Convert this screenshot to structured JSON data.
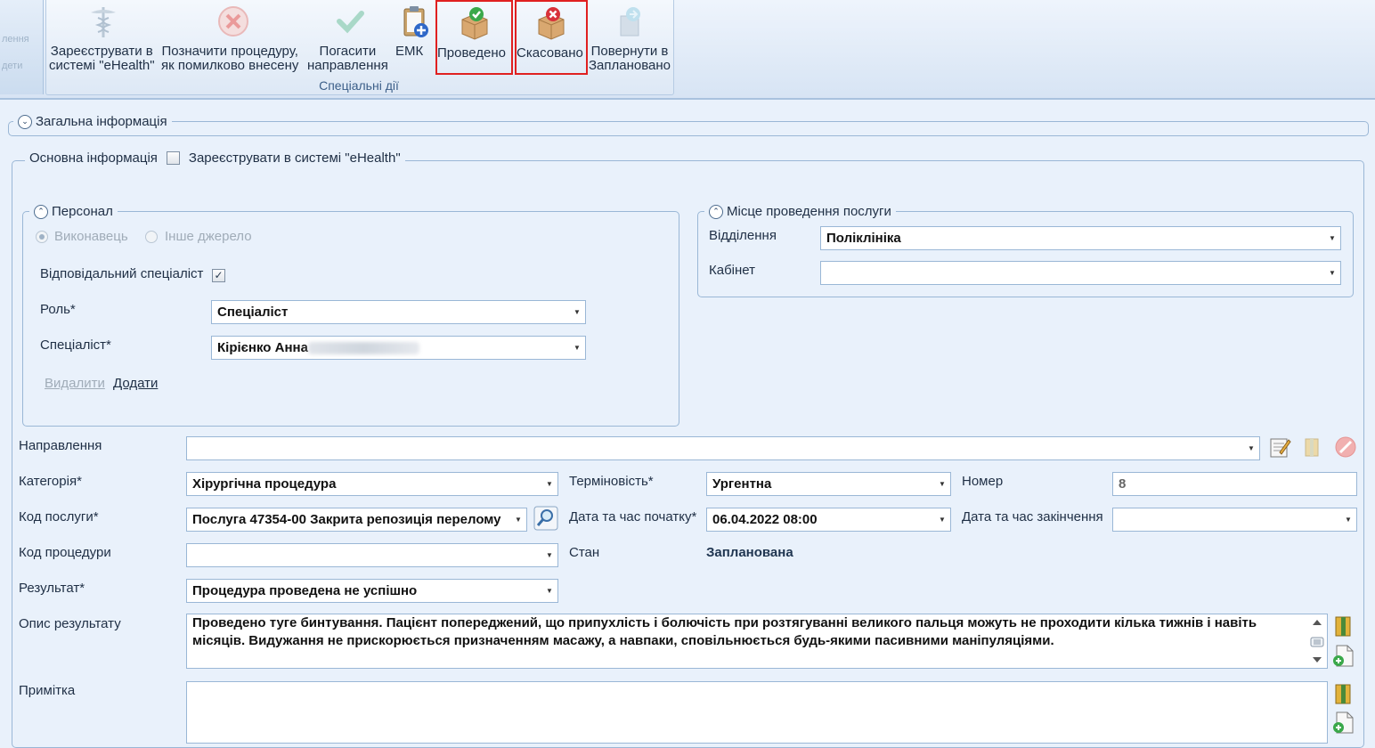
{
  "ribbon": {
    "left_ghost": [
      "лення",
      "дети"
    ],
    "buttons": [
      {
        "label": "Зареєструвати в\nсистемі \"eHealth\"",
        "icon": "caduceus-icon",
        "enabled": false
      },
      {
        "label": "Позначити процедуру,\nяк помилково внесену",
        "icon": "cancel-circle-icon",
        "enabled": false
      },
      {
        "label": "Погасити\nнаправлення",
        "icon": "checkmark-icon",
        "enabled": false
      },
      {
        "label": "ЕМК",
        "icon": "medical-clipboard-icon",
        "enabled": true
      },
      {
        "label": "Проведено",
        "icon": "box-check-icon",
        "enabled": true
      },
      {
        "label": "Скасовано",
        "icon": "box-cancel-icon",
        "enabled": true
      },
      {
        "label": "Повернути в\nЗаплановано",
        "icon": "return-icon",
        "enabled": false
      }
    ],
    "group_label": "Спеціальні дії"
  },
  "general": {
    "title": "Загальна інформація"
  },
  "main_info": {
    "title": "Основна інформація",
    "ehealth_checkbox_label": "Зареєструвати в системі \"eHealth\"",
    "ehealth_checked": false
  },
  "personnel": {
    "title": "Персонал",
    "radio_executor": "Виконавець",
    "radio_other_source": "Інше джерело",
    "responsible_label": "Відповідальний спеціаліст",
    "responsible_checked": true,
    "role_label": "Роль*",
    "role_value": "Спеціаліст",
    "specialist_label": "Спеціаліст*",
    "specialist_value": "Кірієнко Анна",
    "delete_link": "Видалити",
    "add_link": "Додати"
  },
  "place": {
    "title": "Місце проведення послуги",
    "department_label": "Відділення",
    "department_value": "Поліклініка",
    "cabinet_label": "Кабінет",
    "cabinet_value": ""
  },
  "form": {
    "referral_label": "Направлення",
    "referral_value": "",
    "category_label": "Категорія*",
    "category_value": "Хірургічна процедура",
    "urgency_label": "Терміновість*",
    "urgency_value": "Ургентна",
    "number_label": "Номер",
    "number_value": "8",
    "service_code_label": "Код послуги*",
    "service_code_value": "Послуга 47354-00 Закрита репозиція перелому",
    "start_label": "Дата та час початку*",
    "start_value": "06.04.2022 08:00",
    "end_label": "Дата та час закінчення",
    "end_value": "",
    "procedure_code_label": "Код процедури",
    "procedure_code_value": "",
    "state_label": "Стан",
    "state_value": "Запланована",
    "result_label": "Результат*",
    "result_value": "Процедура проведена не успішно",
    "result_desc_label": "Опис результату",
    "result_desc_value": "Проведено туге бинтування. Пацієнт попереджений, що припухлість і болючість при розтягуванні великого пальця можуть не проходити кілька тижнів і навіть місяців. Видужання не прискорюється призначенням масажу, а навпаки, сповільнюється будь-якими пасивними маніпуляціями.",
    "note_label": "Примітка",
    "note_value": ""
  },
  "colors": {
    "background": "#e9f1fb",
    "frame_border": "#9ab7d6",
    "highlight": "#e02020"
  }
}
